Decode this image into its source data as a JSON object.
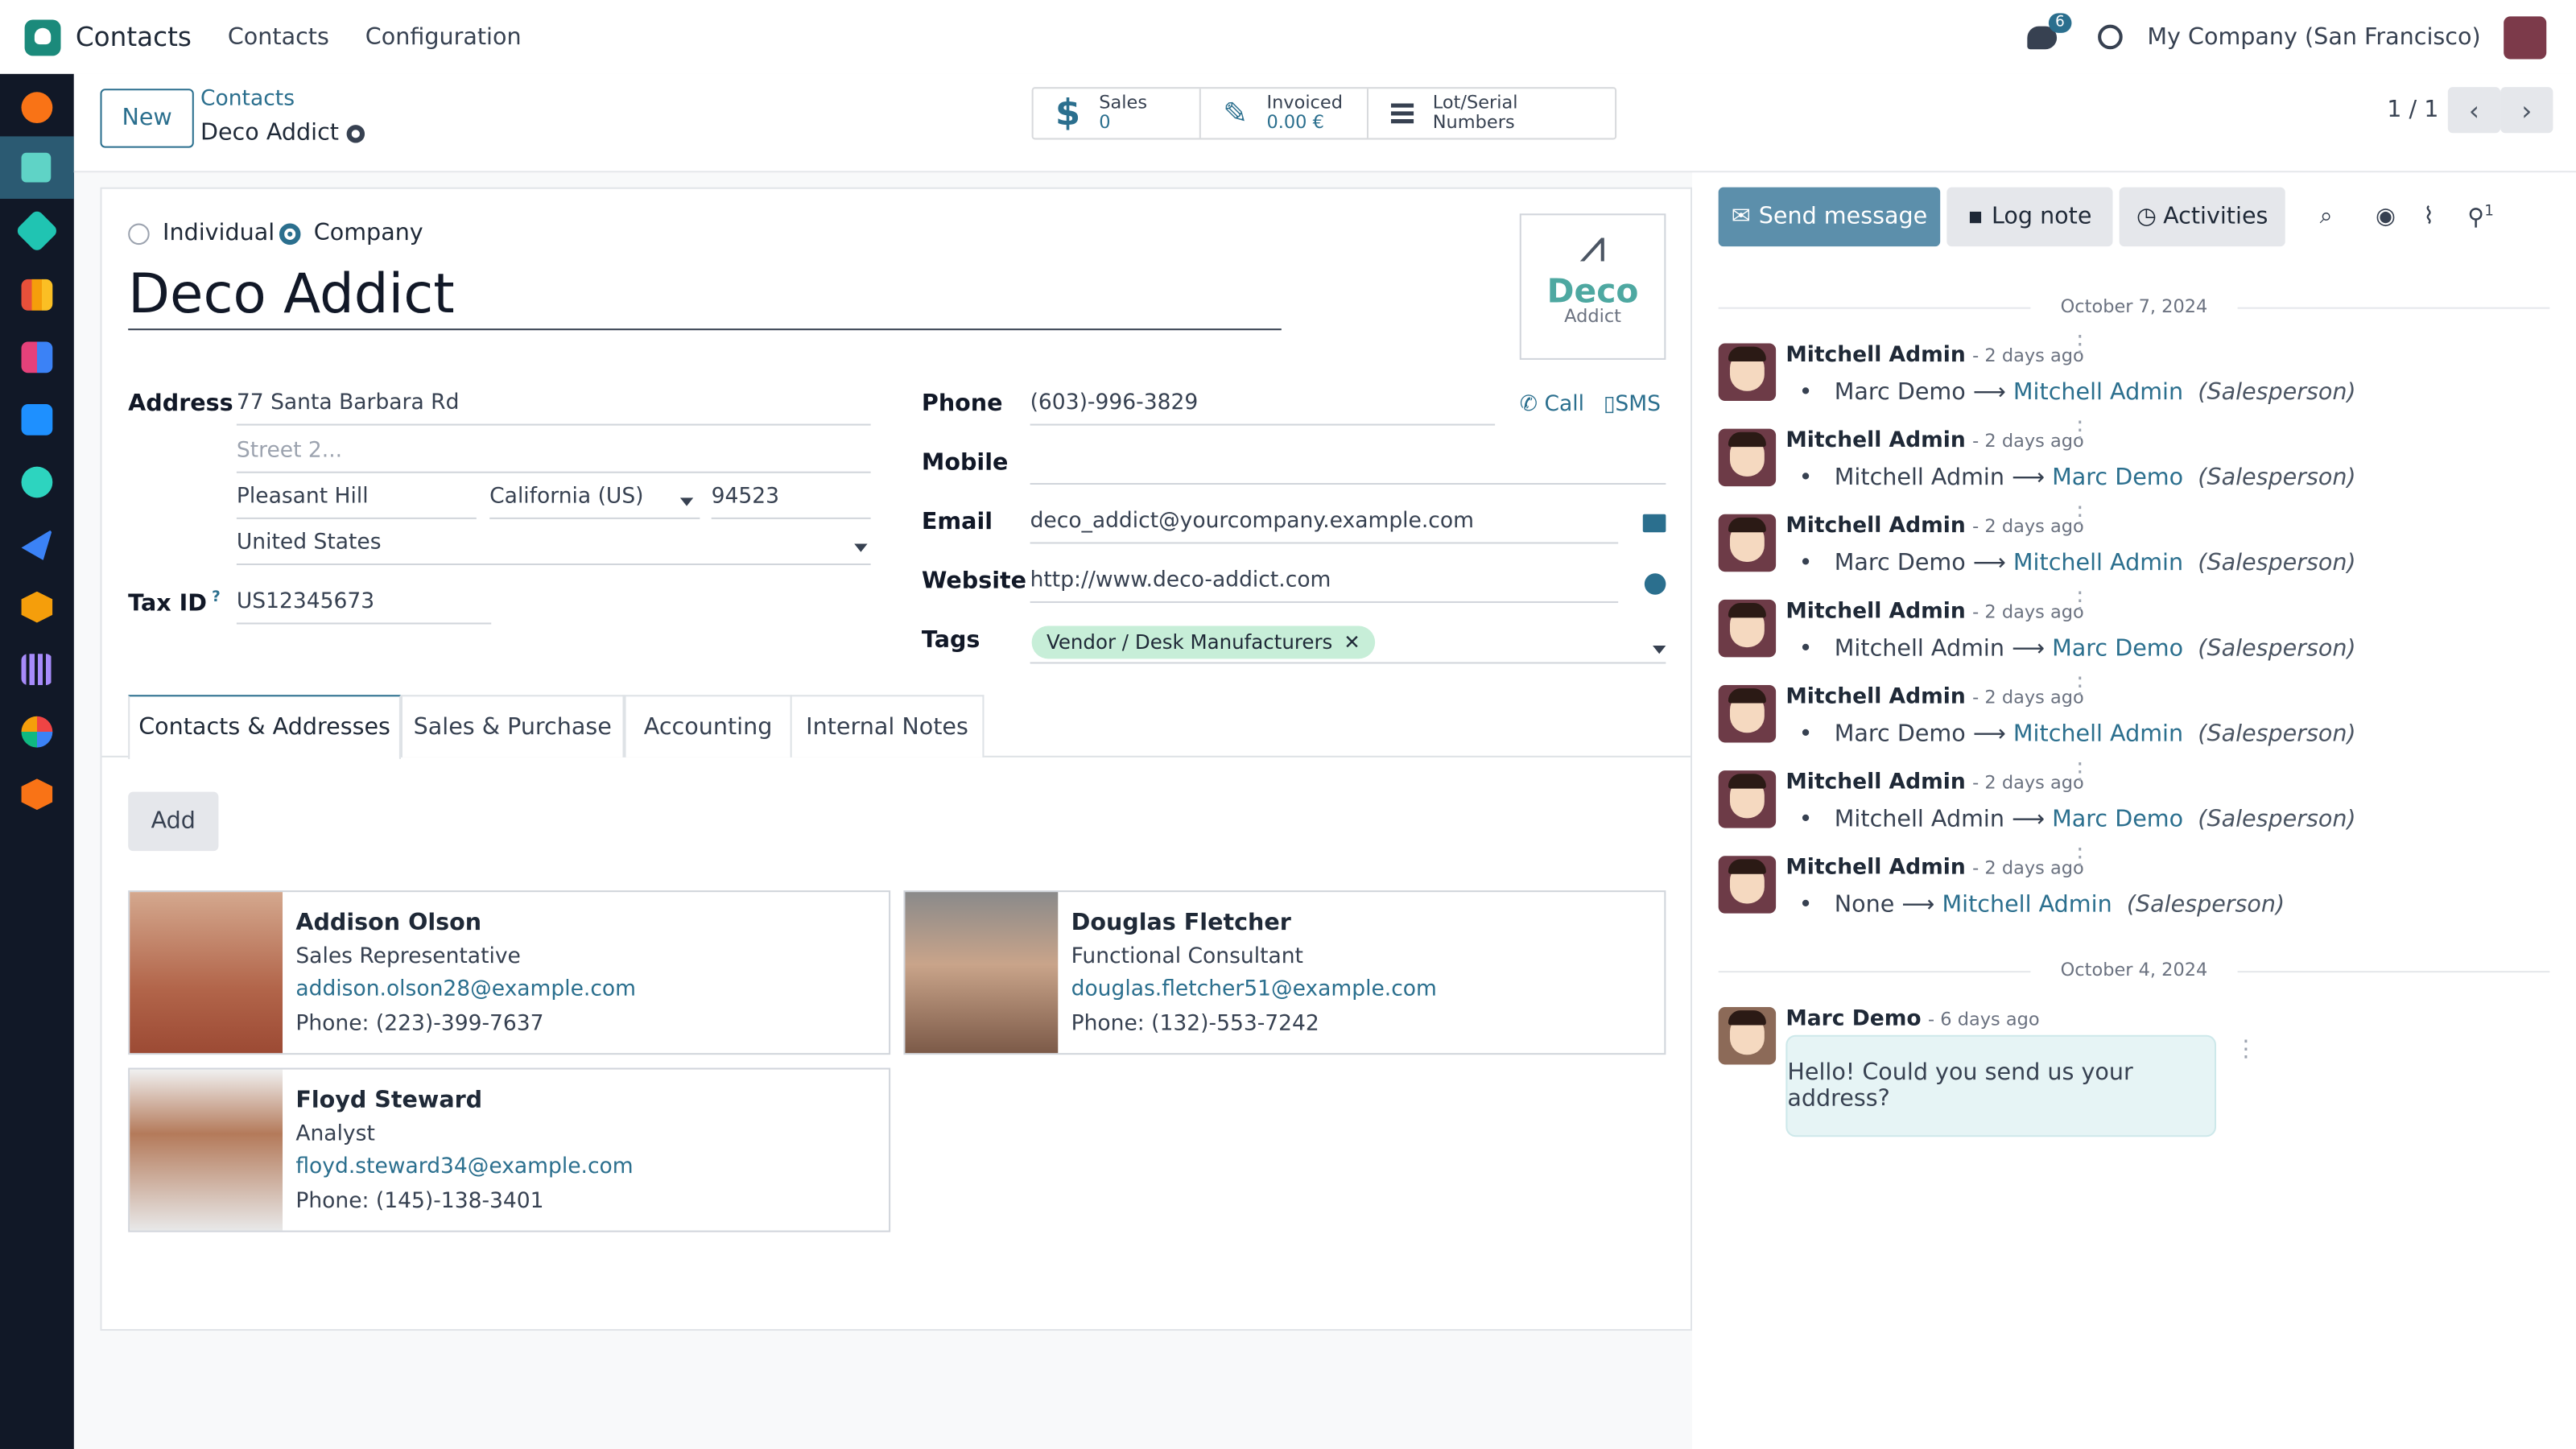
{
  "app": {
    "name": "Contacts",
    "menu": [
      "Contacts",
      "Configuration"
    ],
    "chat_count": "6",
    "company": "My Company (San Francisco)"
  },
  "control": {
    "new_label": "New",
    "breadcrumb_parent": "Contacts",
    "breadcrumb_current": "Deco Addict",
    "pager": "1 / 1"
  },
  "stats": [
    {
      "icon": "$",
      "line1": "Sales",
      "line2": "0"
    },
    {
      "icon": "✎",
      "line1": "Invoiced",
      "line2": "0.00 €"
    },
    {
      "icon": "≡",
      "line1": "Lot/Serial Numbers",
      "line2": ""
    }
  ],
  "form": {
    "type_options": [
      "Individual",
      "Company"
    ],
    "type_selected": "Company",
    "name": "Deco Addict",
    "logo": {
      "line1": "Deco",
      "line2": "Addict"
    },
    "labels": {
      "address": "Address",
      "taxid": "Tax ID",
      "taxid_hint": "?",
      "phone": "Phone",
      "mobile": "Mobile",
      "email": "Email",
      "website": "Website",
      "tags": "Tags"
    },
    "address": {
      "street": "77 Santa Barbara Rd",
      "street2_placeholder": "Street 2...",
      "city": "Pleasant Hill",
      "state": "California (US)",
      "zip": "94523",
      "country": "United States"
    },
    "taxid": "US12345673",
    "phone": "(603)-996-3829",
    "call_label": "Call",
    "sms_label": "SMS",
    "email": "deco_addict@yourcompany.example.com",
    "website": "http://www.deco-addict.com",
    "tag": "Vendor / Desk Manufacturers"
  },
  "tabs": [
    "Contacts & Addresses",
    "Sales & Purchase",
    "Accounting",
    "Internal Notes"
  ],
  "add_label": "Add",
  "contacts": [
    {
      "name": "Addison Olson",
      "role": "Sales Representative",
      "email": "addison.olson28@example.com",
      "phone": "Phone: (223)-399-7637"
    },
    {
      "name": "Douglas Fletcher",
      "role": "Functional Consultant",
      "email": "douglas.fletcher51@example.com",
      "phone": "Phone: (132)-553-7242"
    },
    {
      "name": "Floyd Steward",
      "role": "Analyst",
      "email": "floyd.steward34@example.com",
      "phone": "Phone: (145)-138-3401"
    }
  ],
  "chatter": {
    "buttons": [
      "Send message",
      "Log note",
      "Activities"
    ],
    "follower_count": "1",
    "date1": "October 7, 2024",
    "date2": "October 4, 2024",
    "messages": [
      {
        "author": "Mitchell Admin",
        "time": "- 2 days ago",
        "from": "Marc Demo",
        "to": "Mitchell Admin",
        "field": "(Salesperson)"
      },
      {
        "author": "Mitchell Admin",
        "time": "- 2 days ago",
        "from": "Mitchell Admin",
        "to": "Marc Demo",
        "field": "(Salesperson)"
      },
      {
        "author": "Mitchell Admin",
        "time": "- 2 days ago",
        "from": "Marc Demo",
        "to": "Mitchell Admin",
        "field": "(Salesperson)"
      },
      {
        "author": "Mitchell Admin",
        "time": "- 2 days ago",
        "from": "Mitchell Admin",
        "to": "Marc Demo",
        "field": "(Salesperson)"
      },
      {
        "author": "Mitchell Admin",
        "time": "- 2 days ago",
        "from": "Marc Demo",
        "to": "Mitchell Admin",
        "field": "(Salesperson)"
      },
      {
        "author": "Mitchell Admin",
        "time": "- 2 days ago",
        "from": "Mitchell Admin",
        "to": "Marc Demo",
        "field": "(Salesperson)"
      },
      {
        "author": "Mitchell Admin",
        "time": "- 2 days ago",
        "from": "None",
        "to": "Mitchell Admin",
        "field": "(Salesperson)"
      }
    ],
    "last": {
      "author": "Marc Demo",
      "time": "- 6 days ago",
      "text": "Hello! Could you send us your address?"
    }
  },
  "colors": {
    "accent": "#2b6f8e",
    "sidebar": "#111827",
    "tag": "#c7eed8"
  }
}
